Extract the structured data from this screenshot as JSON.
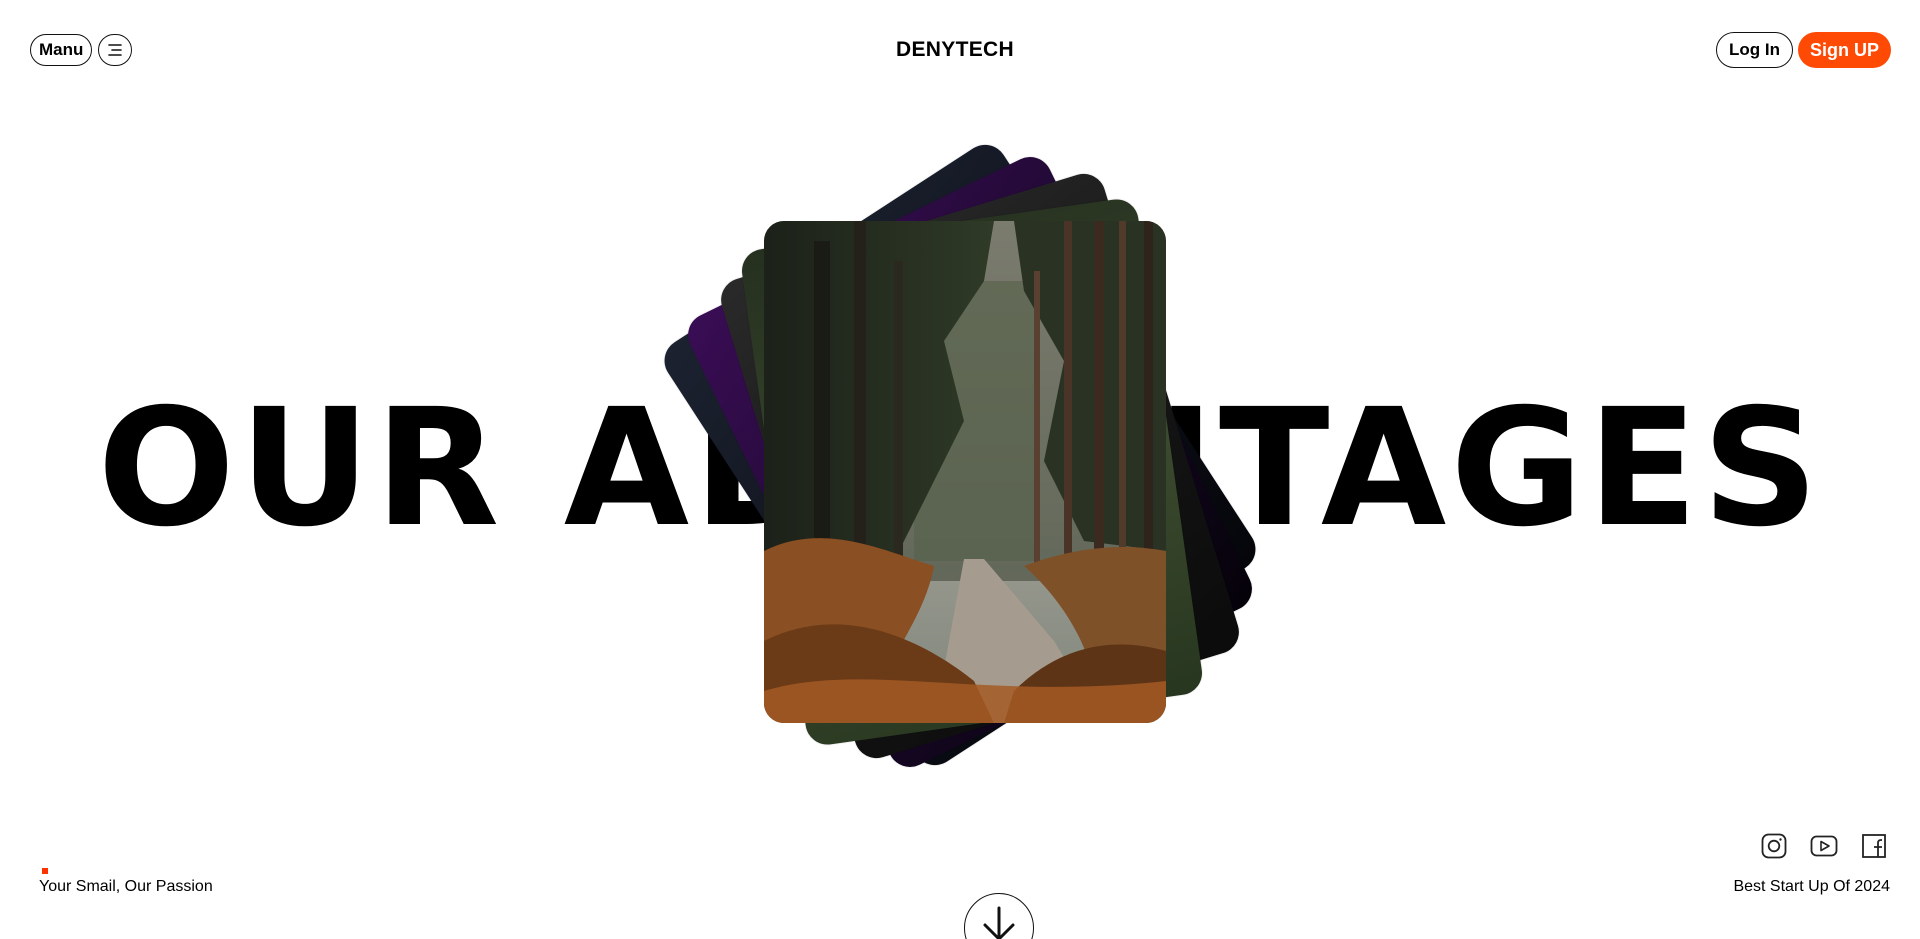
{
  "header": {
    "menu_label": "Manu",
    "brand": "DENYTECH",
    "login_label": "Log In",
    "signup_label": "Sign UP"
  },
  "hero": {
    "headline": "OUR ADVANTAGES"
  },
  "footer": {
    "tagline": "Your Smail, Our Passion",
    "award": "Best Start Up Of 2024"
  },
  "icons": {
    "menu": "menu-lines-icon",
    "instagram": "instagram-icon",
    "youtube": "youtube-icon",
    "facebook": "facebook-icon",
    "scroll": "arrow-down-icon"
  },
  "colors": {
    "accent": "#ff4a06",
    "text": "#000000",
    "background": "#ffffff"
  }
}
